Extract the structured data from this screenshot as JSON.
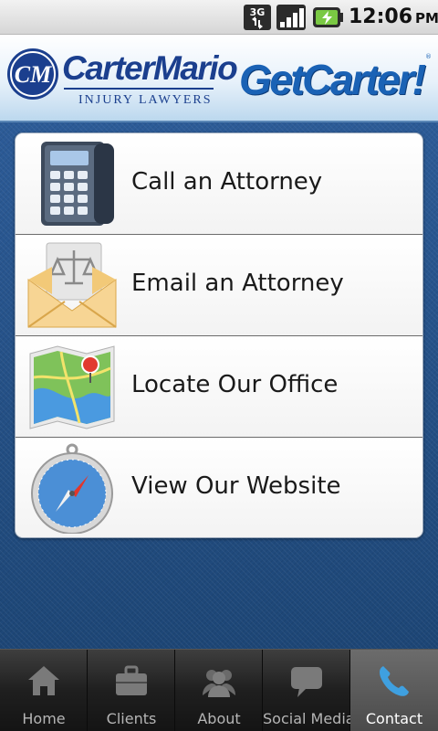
{
  "status_bar": {
    "network_label": "3G",
    "time": "12:06",
    "ampm": "PM",
    "icons": [
      "network-3g-icon",
      "signal-strength-icon",
      "battery-charging-icon"
    ]
  },
  "header": {
    "logo_monogram": "CM",
    "brand_name": "CarterMario",
    "brand_subtitle": "INJURY LAWYERS",
    "tagline": "GetCarter!",
    "tagline_mark": "®"
  },
  "menu": {
    "items": [
      {
        "label": "Call an Attorney",
        "icon": "desk-phone-icon"
      },
      {
        "label": "Email an Attorney",
        "icon": "envelope-scales-icon"
      },
      {
        "label": "Locate Our Office",
        "icon": "map-pin-icon"
      },
      {
        "label": "View Our Website",
        "icon": "compass-icon"
      }
    ]
  },
  "tabs": [
    {
      "label": "Home",
      "icon": "home-icon",
      "active": false
    },
    {
      "label": "Clients",
      "icon": "briefcase-icon",
      "active": false
    },
    {
      "label": "About",
      "icon": "people-icon",
      "active": false
    },
    {
      "label": "Social Media",
      "icon": "speech-bubble-icon",
      "active": false
    },
    {
      "label": "Contact",
      "icon": "phone-handset-icon",
      "active": true
    }
  ],
  "colors": {
    "brand_navy": "#1b3f8e",
    "tagline_blue": "#1a62b5",
    "background_blue": "#24508a",
    "active_tab_accent": "#3fa0e0"
  }
}
